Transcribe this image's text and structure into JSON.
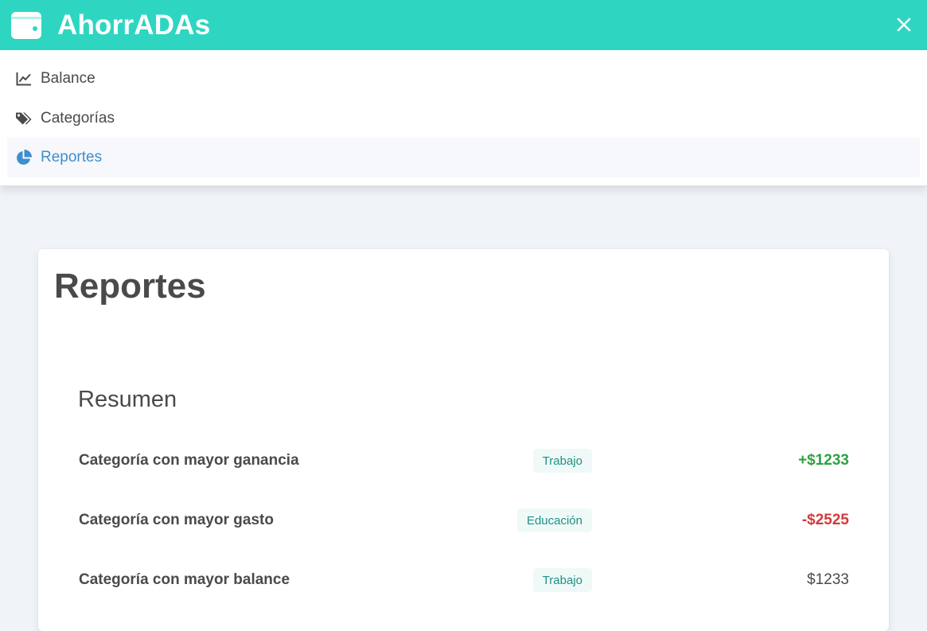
{
  "header": {
    "brand_title": "AhorrADAs",
    "brand_icon": "wallet-icon",
    "close_icon": "close-icon",
    "bg_color": "#2ed6c2"
  },
  "menu": {
    "items": [
      {
        "label": "Balance",
        "icon": "line-chart-icon",
        "active": false
      },
      {
        "label": "Categorías",
        "icon": "tags-icon",
        "active": false
      },
      {
        "label": "Reportes",
        "icon": "pie-chart-icon",
        "active": true
      }
    ],
    "active_color": "#3e8ed0"
  },
  "report": {
    "title": "Reportes",
    "summary_title": "Resumen",
    "rows": [
      {
        "label": "Categoría con mayor ganancia",
        "tag": "Trabajo",
        "amount": "+$1233"
      },
      {
        "label": "Categoría con mayor gasto",
        "tag": "Educación",
        "amount": "-$2525"
      },
      {
        "label": "Categoría con mayor balance",
        "tag": "Trabajo",
        "amount": "$1233"
      }
    ],
    "positive_color": "#2aa33f",
    "negative_color": "#d33a3a"
  }
}
